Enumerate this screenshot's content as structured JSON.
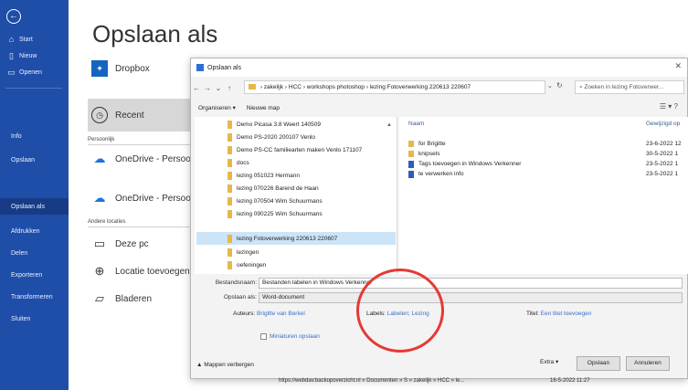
{
  "rail": {
    "back_icon": "back-arrow-icon",
    "items": [
      {
        "label": "Start",
        "icon": "home-icon"
      },
      {
        "label": "Nieuw",
        "icon": "new-document-icon"
      },
      {
        "label": "Openen",
        "icon": "open-folder-icon"
      }
    ],
    "links": [
      "Info",
      "Opslaan",
      "Opslaan als",
      "Afdrukken",
      "Delen",
      "Exporteren",
      "Transformeren",
      "Sluiten"
    ],
    "selected": "Opslaan als"
  },
  "main": {
    "title": "Opslaan als",
    "dropbox": "Dropbox",
    "recent": "Recent",
    "personal_header": "Persoonlijk",
    "onedrive1": "OneDrive - Persoonlijk",
    "onedrive2": "OneDrive - Persoonlijk",
    "other_header": "Andere locaties",
    "this_pc": "Deze pc",
    "add_location": "Locatie toevoegen",
    "browse": "Bladeren"
  },
  "dialog": {
    "title": "Opslaan als",
    "address": [
      "zakelijk",
      "HCC",
      "workshops photoshop",
      "lezing Fotoverwerking 220613 220607"
    ],
    "search_placeholder": "Zoeken in lezing Fotoverwer...",
    "organize": "Organiseren",
    "new_folder": "Nieuwe map",
    "nav_folders": [
      "Demo Picasa 3.8 Weert 140509",
      "Demo PS-2020 200107 Venlo",
      "Demo PS-CC familiearten maken Venlo 171107",
      "docs",
      "lezing 051023 Hermann",
      "lezing 070226 Barend de Haan",
      "lezing 070504 Wim Schuurmans",
      "lezing 090225 Wim Schuurmans",
      "lezing Fotoverwerking 220613 220607",
      "lezingen",
      "oefeningen"
    ],
    "selected_folder": "lezing Fotoverwerking 220613 220607",
    "col_name": "Naam",
    "col_modified": "Gewijzigd op",
    "files": [
      {
        "name": "for Brigitte",
        "date": "23-6-2022 12",
        "type": "folder"
      },
      {
        "name": "knipsels",
        "date": "30-5-2022 1",
        "type": "folder"
      },
      {
        "name": "Tags toevoegen in Windows Verkenner",
        "date": "23-5-2022 1",
        "type": "doc"
      },
      {
        "name": "te verwerken info",
        "date": "23-5-2022 1",
        "type": "doc"
      }
    ],
    "filename_label": "Bestandsnaam:",
    "filename_value": "Bestanden labelen in Windows Verkenner",
    "savetype_label": "Opslaan als:",
    "savetype_value": "Word-document",
    "authors_label": "Auteurs:",
    "authors_value": "Brigitte van Berkel",
    "tags_label": "Labels:",
    "tags_value": "Labelen; Lezing",
    "title_label": "Titel:",
    "title_value": "Een titel toevoegen",
    "thumbnail_label": "Miniaturen opslaan",
    "hide_folders": "Mappen verbergen",
    "extra": "Extra",
    "save": "Opslaan",
    "cancel": "Annuleren"
  },
  "underneath": {
    "path": "https://webdav.backupoverzicht.nl » Documenten » S » zakelijk » HCC » le...",
    "date": "16-5-2022 11:27"
  },
  "colors": {
    "rail": "#1f4ea8",
    "accent": "#2b6fd6",
    "annotation": "#e53935"
  }
}
